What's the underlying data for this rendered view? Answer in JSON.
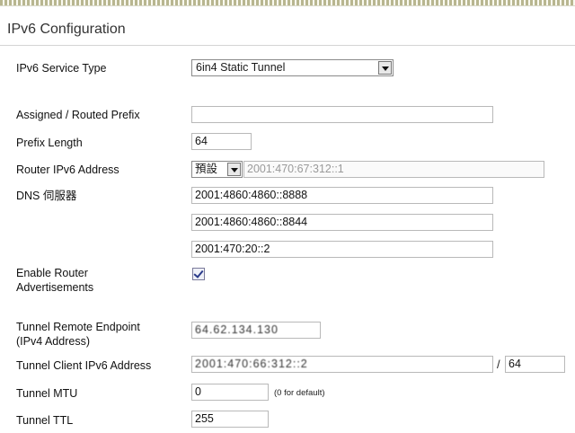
{
  "page": {
    "title": "IPv6 Configuration"
  },
  "fields": {
    "service_type": {
      "label": "IPv6 Service Type",
      "value": "6in4 Static Tunnel"
    },
    "routed_prefix": {
      "label": "Assigned / Routed Prefix",
      "value": ""
    },
    "prefix_length": {
      "label": "Prefix Length",
      "value": "64"
    },
    "router_ipv6": {
      "label": "Router IPv6 Address",
      "mode": "預設",
      "value": "2001:470:67:312::1"
    },
    "dns": {
      "label": "DNS 伺服器",
      "values": [
        "2001:4860:4860::8888",
        "2001:4860:4860::8844",
        "2001:470:20::2"
      ]
    },
    "router_adv": {
      "label_line1": "Enable Router",
      "label_line2": "Advertisements",
      "checked": true
    },
    "remote_endpoint": {
      "label_line1": "Tunnel Remote Endpoint",
      "label_line2": "(IPv4 Address)",
      "value": "64.62.134.130"
    },
    "client_ipv6": {
      "label": "Tunnel Client IPv6 Address",
      "value": "2001:470:66:312::2",
      "slash": "/",
      "prefix": "64"
    },
    "mtu": {
      "label": "Tunnel MTU",
      "value": "0",
      "hint": "(0 for default)"
    },
    "ttl": {
      "label": "Tunnel TTL",
      "value": "255"
    }
  }
}
